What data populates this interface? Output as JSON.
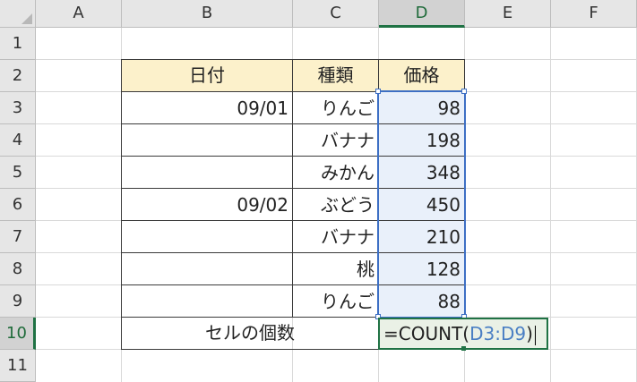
{
  "columns": [
    "A",
    "B",
    "C",
    "D",
    "E",
    "F"
  ],
  "rows": [
    "1",
    "2",
    "3",
    "4",
    "5",
    "6",
    "7",
    "8",
    "9",
    "10",
    "11"
  ],
  "active_column": "D",
  "active_row": "10",
  "table": {
    "headers": {
      "date": "日付",
      "kind": "種類",
      "price": "価格"
    },
    "records": [
      {
        "date": "09/01",
        "kind": "りんご",
        "price": "98"
      },
      {
        "date": "",
        "kind": "バナナ",
        "price": "198"
      },
      {
        "date": "",
        "kind": "みかん",
        "price": "348"
      },
      {
        "date": "09/02",
        "kind": "ぶどう",
        "price": "450"
      },
      {
        "date": "",
        "kind": "バナナ",
        "price": "210"
      },
      {
        "date": "",
        "kind": "桃",
        "price": "128"
      },
      {
        "date": "",
        "kind": "りんご",
        "price": "88"
      }
    ],
    "count_label": "セルの個数"
  },
  "formula": {
    "prefix": "=COUNT(",
    "range": "D3:D9",
    "suffix": ")"
  },
  "colors": {
    "header_fill": "#fcf1cb",
    "selection_border": "#3d6fc4",
    "active_green": "#1f7244",
    "range_text": "#4a7fc4"
  }
}
